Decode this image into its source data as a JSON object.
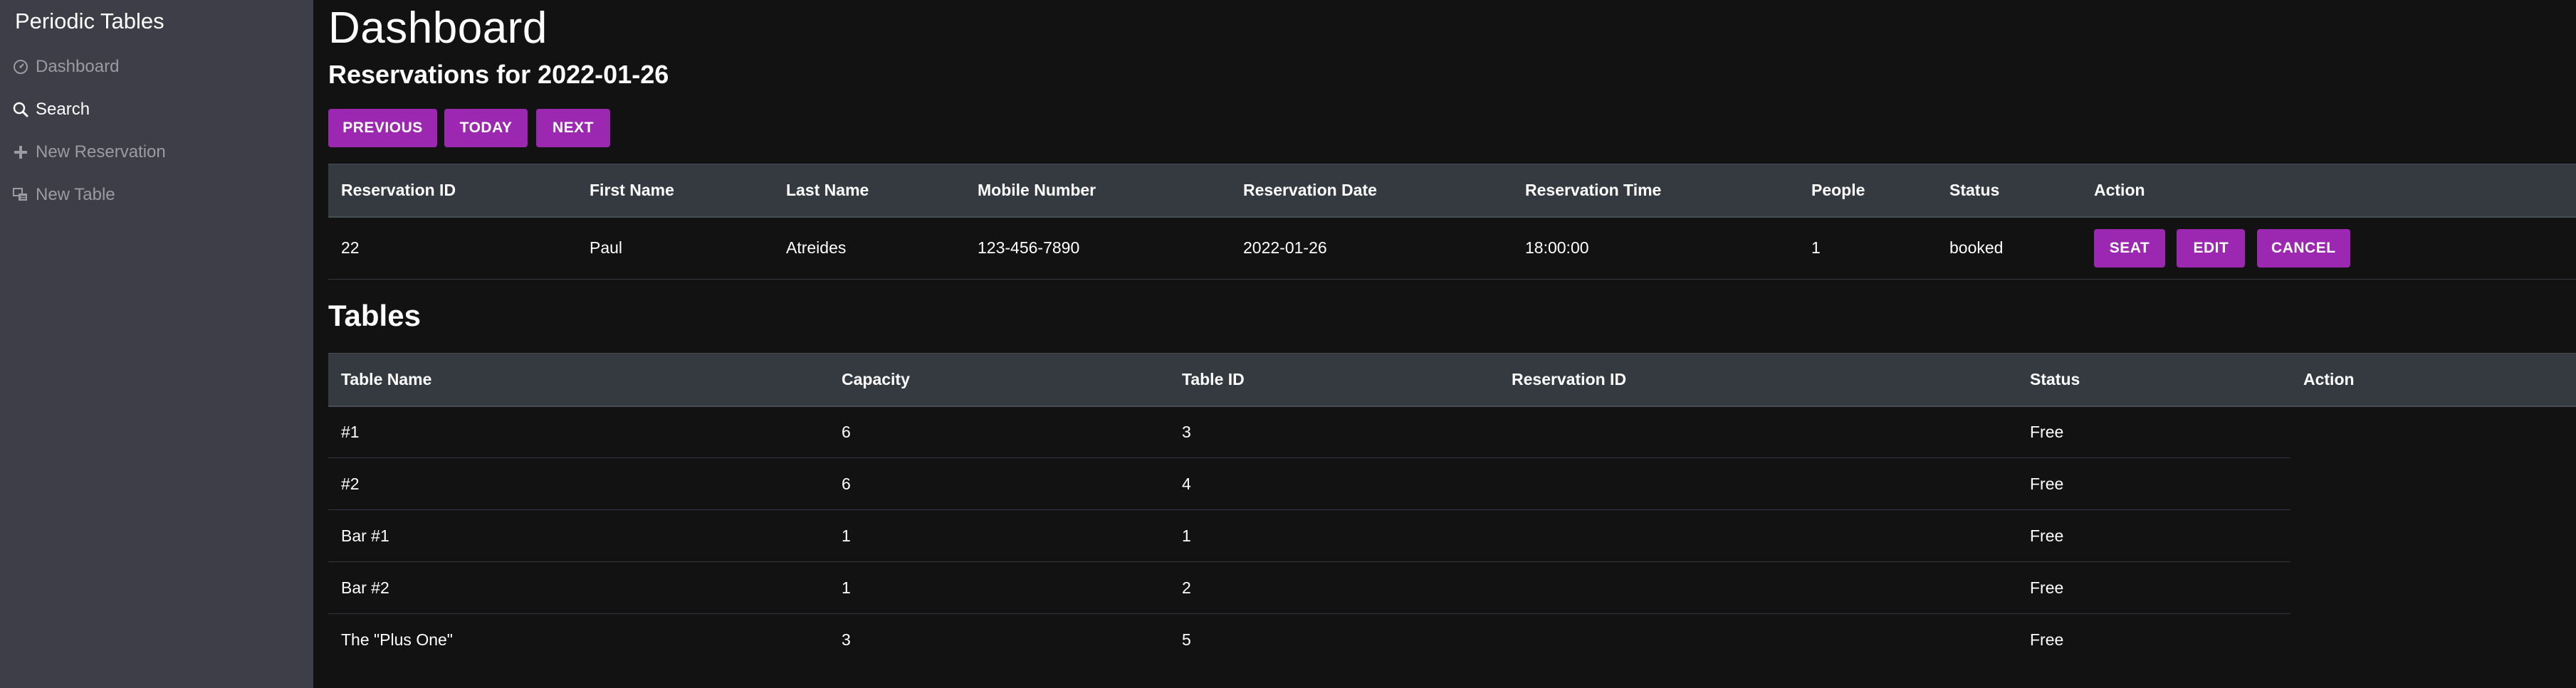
{
  "sidebar": {
    "brand": "Periodic Tables",
    "items": [
      {
        "label": "Dashboard",
        "icon": "dashboard-icon"
      },
      {
        "label": "Search",
        "icon": "search-icon"
      },
      {
        "label": "New Reservation",
        "icon": "plus-icon"
      },
      {
        "label": "New Table",
        "icon": "table-icon"
      }
    ]
  },
  "main": {
    "title": "Dashboard",
    "subtitle": "Reservations for 2022-01-26",
    "buttons": {
      "previous": "Previous",
      "today": "Today",
      "next": "Next"
    },
    "reservations": {
      "headers": [
        "Reservation ID",
        "First Name",
        "Last Name",
        "Mobile Number",
        "Reservation Date",
        "Reservation Time",
        "People",
        "Status",
        "Action"
      ],
      "rows": [
        {
          "id": "22",
          "first_name": "Paul",
          "last_name": "Atreides",
          "mobile": "123-456-7890",
          "date": "2022-01-26",
          "time": "18:00:00",
          "people": "1",
          "status": "booked",
          "actions": {
            "seat": "Seat",
            "edit": "Edit",
            "cancel": "Cancel"
          }
        }
      ]
    },
    "tables_title": "Tables",
    "tables": {
      "headers": [
        "Table Name",
        "Capacity",
        "Table ID",
        "Reservation ID",
        "Status",
        "Action"
      ],
      "rows": [
        {
          "name": "#1",
          "capacity": "6",
          "table_id": "3",
          "reservation_id": "",
          "status": "Free"
        },
        {
          "name": "#2",
          "capacity": "6",
          "table_id": "4",
          "reservation_id": "",
          "status": "Free"
        },
        {
          "name": "Bar #1",
          "capacity": "1",
          "table_id": "1",
          "reservation_id": "",
          "status": "Free"
        },
        {
          "name": "Bar #2",
          "capacity": "1",
          "table_id": "2",
          "reservation_id": "",
          "status": "Free"
        },
        {
          "name": "The \"Plus One\"",
          "capacity": "3",
          "table_id": "5",
          "reservation_id": "",
          "status": "Free"
        }
      ]
    }
  },
  "colors": {
    "accent": "#9c27b0",
    "sidebar_bg": "#3d3e48",
    "page_bg": "#121212",
    "table_header_bg": "#353a40"
  }
}
